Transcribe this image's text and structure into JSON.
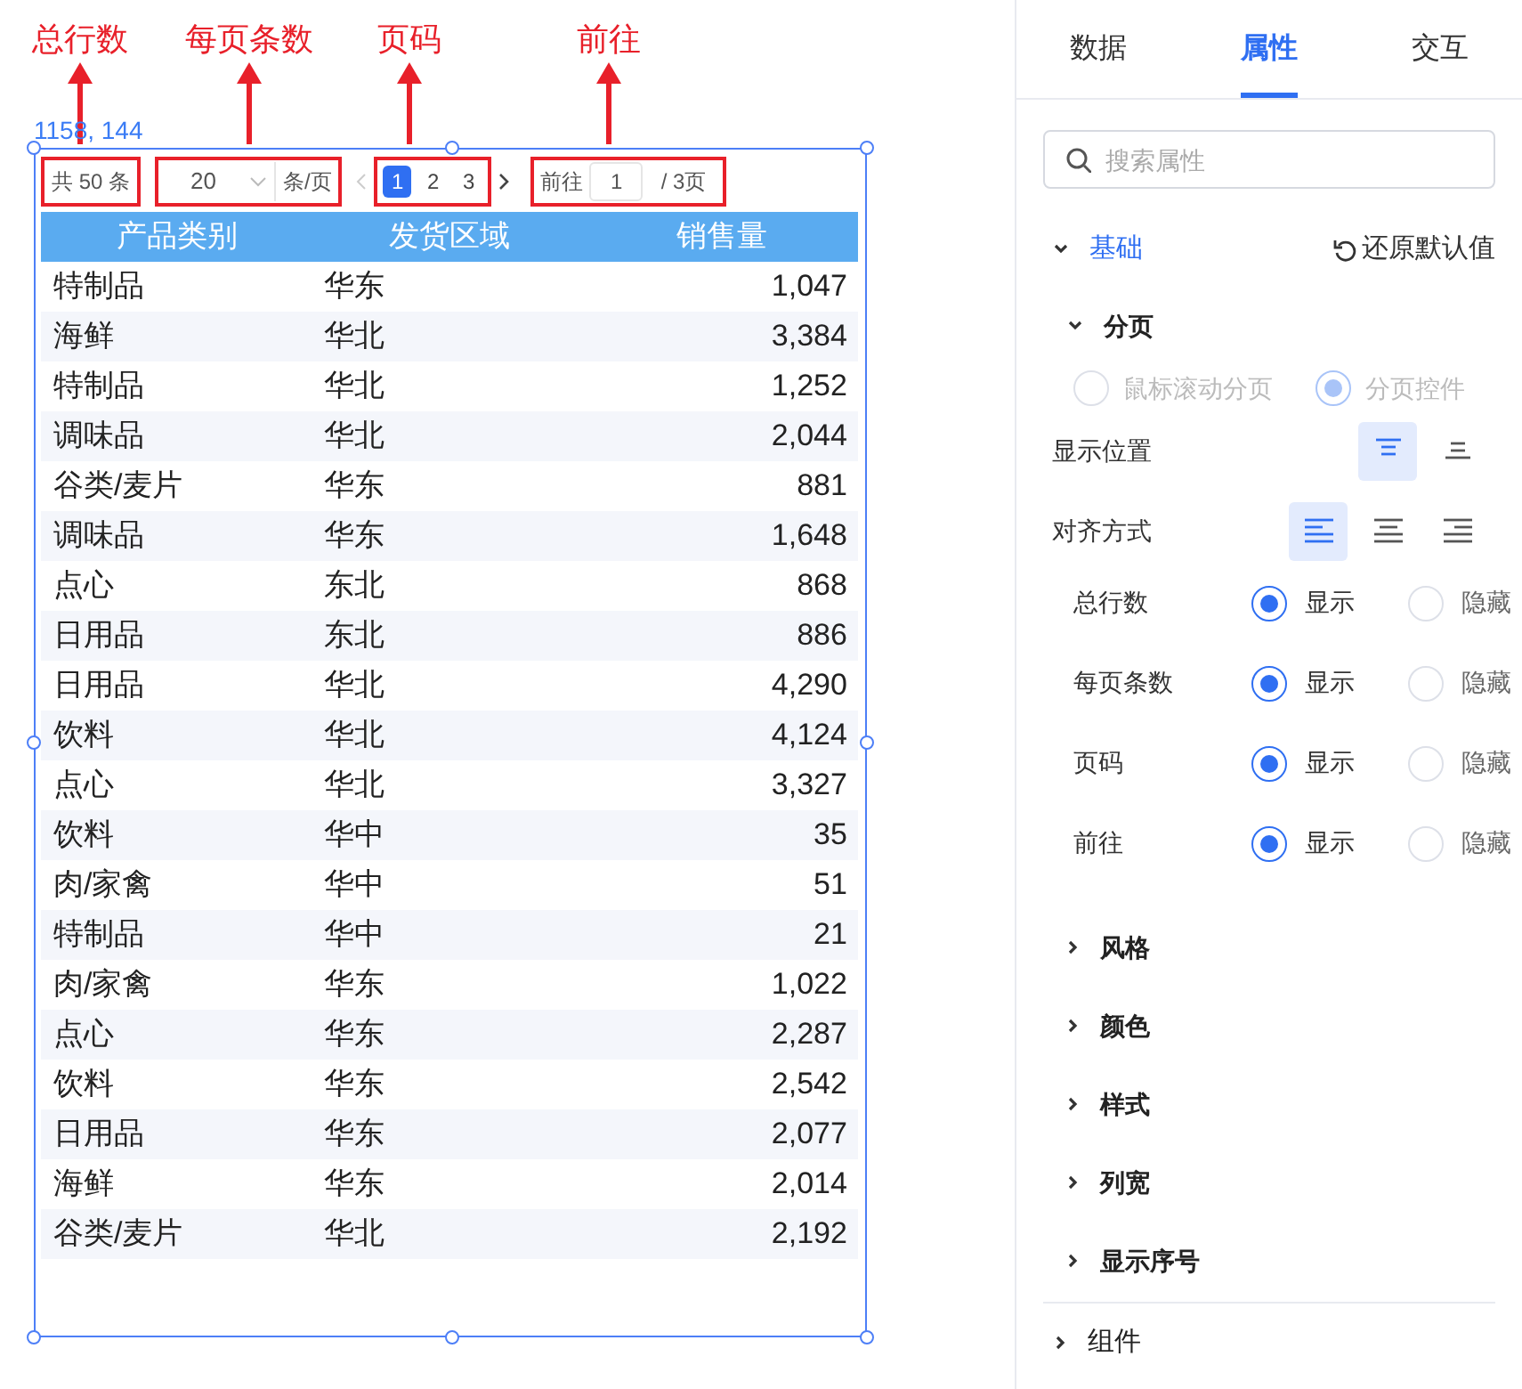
{
  "annotations": [
    {
      "label": "总行数"
    },
    {
      "label": "每页条数"
    },
    {
      "label": "页码"
    },
    {
      "label": "前往"
    }
  ],
  "coordinates": "1158, 144",
  "pagination": {
    "total": "共 50 条",
    "page_size": "20",
    "page_size_unit": "条/页",
    "pages": [
      {
        "label": "1",
        "selected": true
      },
      {
        "label": "2",
        "selected": false
      },
      {
        "label": "3",
        "selected": false
      }
    ],
    "goto_label": "前往",
    "goto_value": "1",
    "goto_total": "/ 3页"
  },
  "table": {
    "columns": [
      "产品类别",
      "发货区域",
      "销售量"
    ],
    "rows": [
      [
        "特制品",
        "华东",
        "1,047"
      ],
      [
        "海鲜",
        "华北",
        "3,384"
      ],
      [
        "特制品",
        "华北",
        "1,252"
      ],
      [
        "调味品",
        "华北",
        "2,044"
      ],
      [
        "谷类/麦片",
        "华东",
        "881"
      ],
      [
        "调味品",
        "华东",
        "1,648"
      ],
      [
        "点心",
        "东北",
        "868"
      ],
      [
        "日用品",
        "东北",
        "886"
      ],
      [
        "日用品",
        "华北",
        "4,290"
      ],
      [
        "饮料",
        "华北",
        "4,124"
      ],
      [
        "点心",
        "华北",
        "3,327"
      ],
      [
        "饮料",
        "华中",
        "35"
      ],
      [
        "肉/家禽",
        "华中",
        "51"
      ],
      [
        "特制品",
        "华中",
        "21"
      ],
      [
        "肉/家禽",
        "华东",
        "1,022"
      ],
      [
        "点心",
        "华东",
        "2,287"
      ],
      [
        "饮料",
        "华东",
        "2,542"
      ],
      [
        "日用品",
        "华东",
        "2,077"
      ],
      [
        "海鲜",
        "华东",
        "2,014"
      ],
      [
        "谷类/麦片",
        "华北",
        "2,192"
      ]
    ]
  },
  "panel": {
    "tabs": [
      {
        "label": "数据",
        "selected": false
      },
      {
        "label": "属性",
        "selected": true
      },
      {
        "label": "交互",
        "selected": false
      }
    ],
    "search": {
      "placeholder": "搜索属性"
    },
    "section": {
      "title": "基础",
      "expanded": true,
      "reset": "还原默认值"
    },
    "group": {
      "title": "分页",
      "expanded": true
    },
    "mode": {
      "disabled": true,
      "options": [
        {
          "label": "鼠标滚动分页",
          "selected": false
        },
        {
          "label": "分页控件",
          "selected": true
        }
      ]
    },
    "position": {
      "label": "显示位置",
      "options": [
        {
          "kind": "top",
          "selected": true
        },
        {
          "kind": "bottom",
          "selected": false
        }
      ]
    },
    "align": {
      "label": "对齐方式",
      "options": [
        {
          "kind": "left",
          "selected": true
        },
        {
          "kind": "center",
          "selected": false
        },
        {
          "kind": "right",
          "selected": false
        }
      ]
    },
    "toggles": [
      {
        "label": "总行数",
        "options": [
          {
            "label": "显示",
            "selected": true
          },
          {
            "label": "隐藏",
            "selected": false
          }
        ]
      },
      {
        "label": "每页条数",
        "options": [
          {
            "label": "显示",
            "selected": true
          },
          {
            "label": "隐藏",
            "selected": false
          }
        ]
      },
      {
        "label": "页码",
        "options": [
          {
            "label": "显示",
            "selected": true
          },
          {
            "label": "隐藏",
            "selected": false
          }
        ]
      },
      {
        "label": "前往",
        "options": [
          {
            "label": "显示",
            "selected": true
          },
          {
            "label": "隐藏",
            "selected": false
          }
        ]
      }
    ],
    "groups": [
      {
        "title": "风格",
        "expanded": false
      },
      {
        "title": "颜色",
        "expanded": false
      },
      {
        "title": "样式",
        "expanded": false
      },
      {
        "title": "列宽",
        "expanded": false
      },
      {
        "title": "显示序号",
        "expanded": false
      }
    ],
    "footer": {
      "title": "组件",
      "expanded": false
    }
  }
}
